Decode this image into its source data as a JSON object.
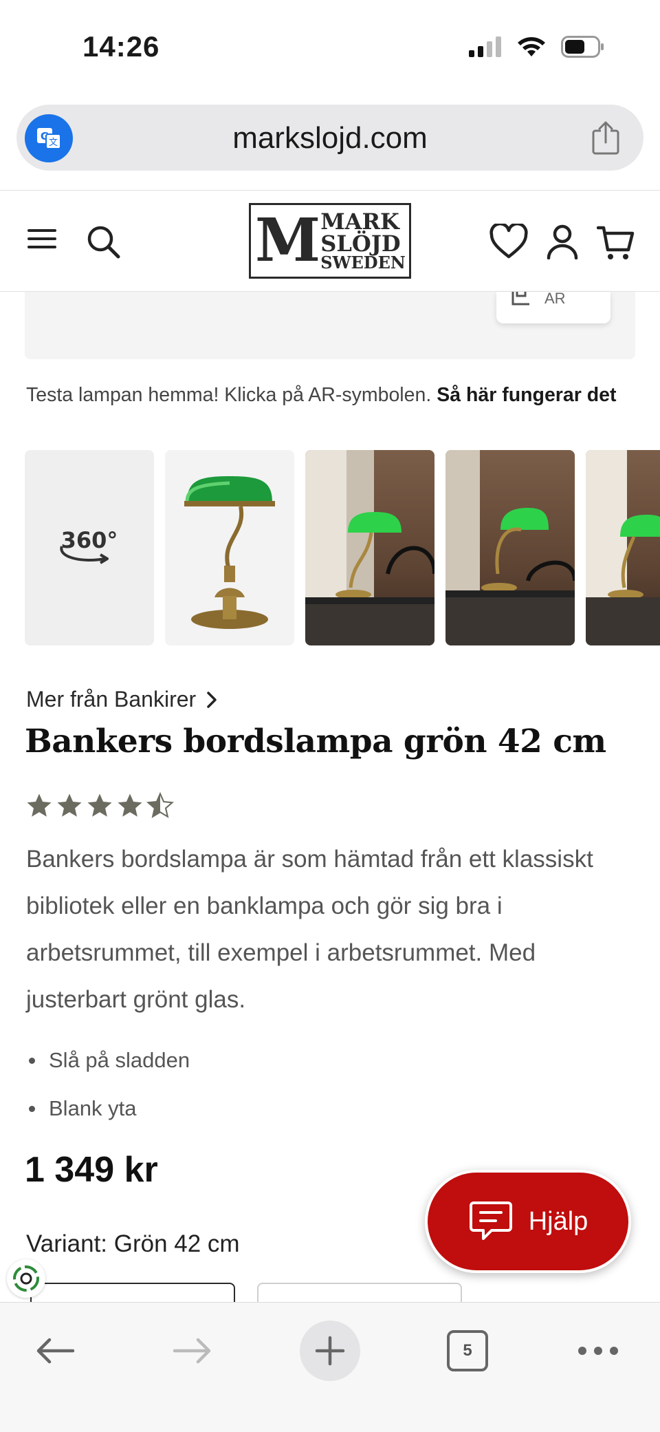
{
  "status_bar": {
    "time": "14:26"
  },
  "browser": {
    "url": "markslojd.com"
  },
  "site": {
    "logo": {
      "letter": "M",
      "line1": "MARK",
      "line2": "SLÖJD",
      "line3": "SWEDEN"
    }
  },
  "ar": {
    "pill_label": "AR",
    "hint_text": "Testa lampan hemma! Klicka på AR-symbolen.",
    "hint_link": "Så här fungerar det"
  },
  "gallery": {
    "view360_label": "360°",
    "thumbnails": [
      "360-view",
      "product-cutout",
      "room-photo-1",
      "room-photo-2",
      "room-photo-3"
    ]
  },
  "product": {
    "breadcrumb": "Mer från Bankirer",
    "title": "Bankers bordslampa grön 42 cm",
    "rating": 4.5,
    "rating_max": 5,
    "description": "Bankers bordslampa är som hämtad från ett klassiskt bibliotek eller en banklampa och gör sig bra i arbetsrummet, till exempel i arbetsrummet. Med justerbart grönt glas.",
    "features": [
      "Slå på sladden",
      "Blank yta"
    ],
    "price": "1 349 kr",
    "variant_label": "Variant: Grön 42 cm"
  },
  "help": {
    "label": "Hjälp"
  },
  "toolbar": {
    "tab_count": "5"
  },
  "colors": {
    "accent_red": "#c00d0d",
    "translate_blue": "#1a73e8",
    "star_gray": "#6b6b60"
  }
}
